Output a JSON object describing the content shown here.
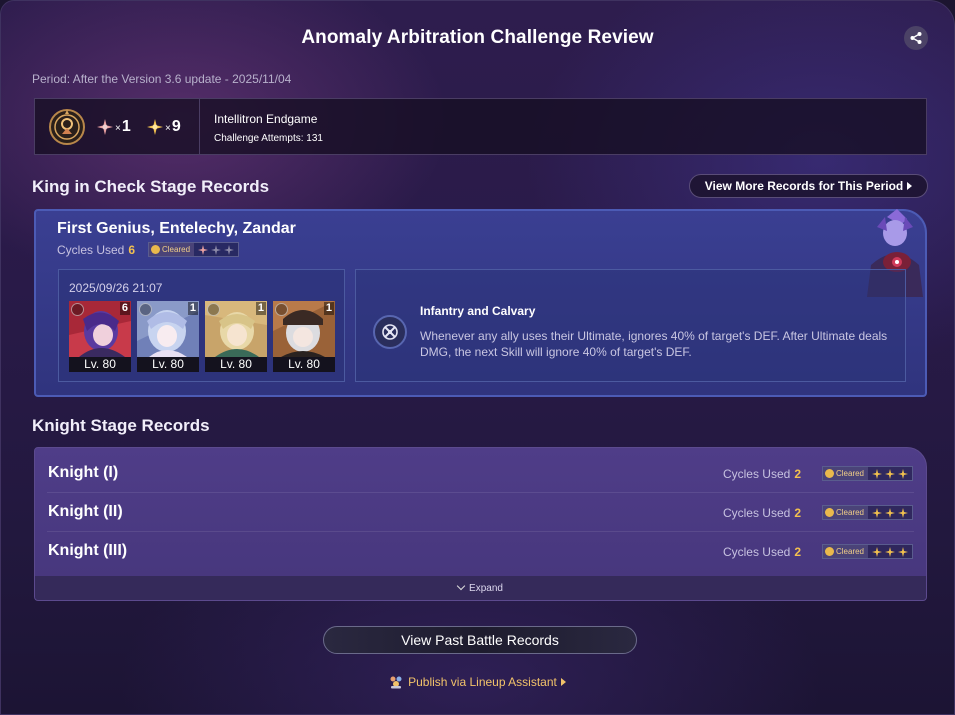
{
  "header": {
    "title": "Anomaly Arbitration Challenge Review",
    "period": "Period: After the Version 3.6 update - 2025/11/04"
  },
  "summary": {
    "badge1_multiplier": "×",
    "badge1_count": "1",
    "badge2_multiplier": "×",
    "badge2_count": "9",
    "name": "Intellitron Endgame",
    "attempts": "Challenge Attempts: 131"
  },
  "king": {
    "section_title": "King in Check Stage Records",
    "more_button": "View More Records for This Period",
    "boss_name": "First Genius, Entelechy, Zandar",
    "cycles_label": "Cycles Used",
    "cycles_value": "6",
    "cleared_label": "Cleared",
    "stars_earned": 1,
    "stars_total": 3,
    "date": "2025/09/26 21:07",
    "team": [
      {
        "level": "Lv. 80",
        "count": "6",
        "palette": [
          "#d03040",
          "#5a3aa0",
          "#e8b0c8"
        ]
      },
      {
        "level": "Lv. 80",
        "count": "1",
        "palette": [
          "#8a9ac8",
          "#c8d4f0",
          "#f4e8f0"
        ]
      },
      {
        "level": "Lv. 80",
        "count": "1",
        "palette": [
          "#c89a5a",
          "#e8d8a8",
          "#3a6a58"
        ]
      },
      {
        "level": "Lv. 80",
        "count": "1",
        "palette": [
          "#b87a4a",
          "#dcdce0",
          "#3a2a24"
        ]
      }
    ],
    "buff_name": "Infantry and Calvary",
    "buff_desc": "Whenever any ally uses their Ultimate, ignores 40% of target's DEF. After Ultimate deals DMG, the next Skill will ignore 40% of target's DEF."
  },
  "knight": {
    "section_title": "Knight Stage Records",
    "rows": [
      {
        "name": "Knight (I)",
        "cycles_label": "Cycles Used",
        "cycles": "2",
        "cleared": "Cleared",
        "stars": 3
      },
      {
        "name": "Knight (II)",
        "cycles_label": "Cycles Used",
        "cycles": "2",
        "cleared": "Cleared",
        "stars": 3
      },
      {
        "name": "Knight (III)",
        "cycles_label": "Cycles Used",
        "cycles": "2",
        "cleared": "Cleared",
        "stars": 3
      }
    ],
    "expand_label": "Expand"
  },
  "footer": {
    "past_button": "View Past Battle Records",
    "publish_link": "Publish via Lineup Assistant"
  },
  "colors": {
    "accent_gold": "#f3c04f",
    "king_card": "#3a3f92",
    "knight_card": "#4f3d88"
  }
}
